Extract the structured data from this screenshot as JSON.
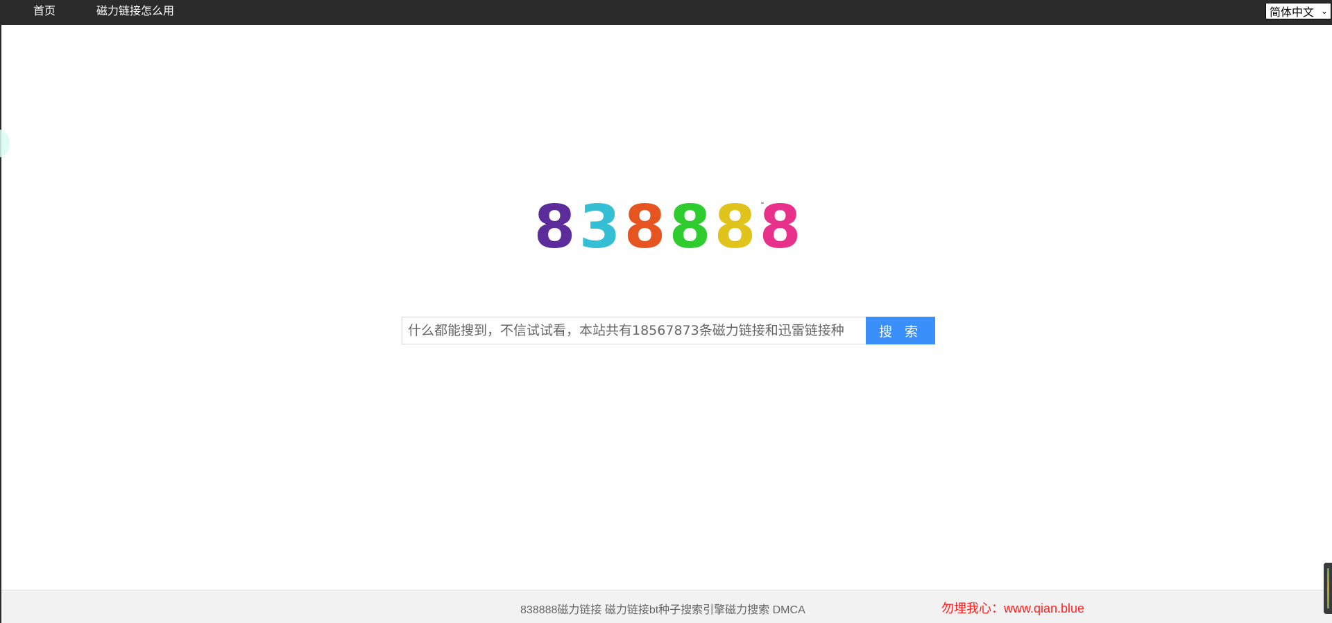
{
  "nav": {
    "home_label": "首页",
    "howto_label": "磁力链接怎么用",
    "language": "简体中文"
  },
  "logo": {
    "digits": [
      {
        "char": "8",
        "color": "#5b2c9a"
      },
      {
        "char": "3",
        "color": "#34bfd4"
      },
      {
        "char": "8",
        "color": "#e6541f"
      },
      {
        "char": "8",
        "color": "#2ecc2e"
      },
      {
        "char": "8",
        "color": "#e1c41b"
      },
      {
        "char": "8",
        "color": "#e8318a"
      }
    ]
  },
  "search": {
    "placeholder": "什么都能搜到，不信试试看，本站共有18567873条磁力链接和迅雷链接种",
    "button_label": "搜 索",
    "accent_color": "#3b8ffb"
  },
  "footer": {
    "text": "838888磁力链接 磁力链接bt种子搜索引擎磁力搜索 DMCA",
    "contact": "勿埋我心：www.qian.blue",
    "contact_color": "#ff2020"
  }
}
